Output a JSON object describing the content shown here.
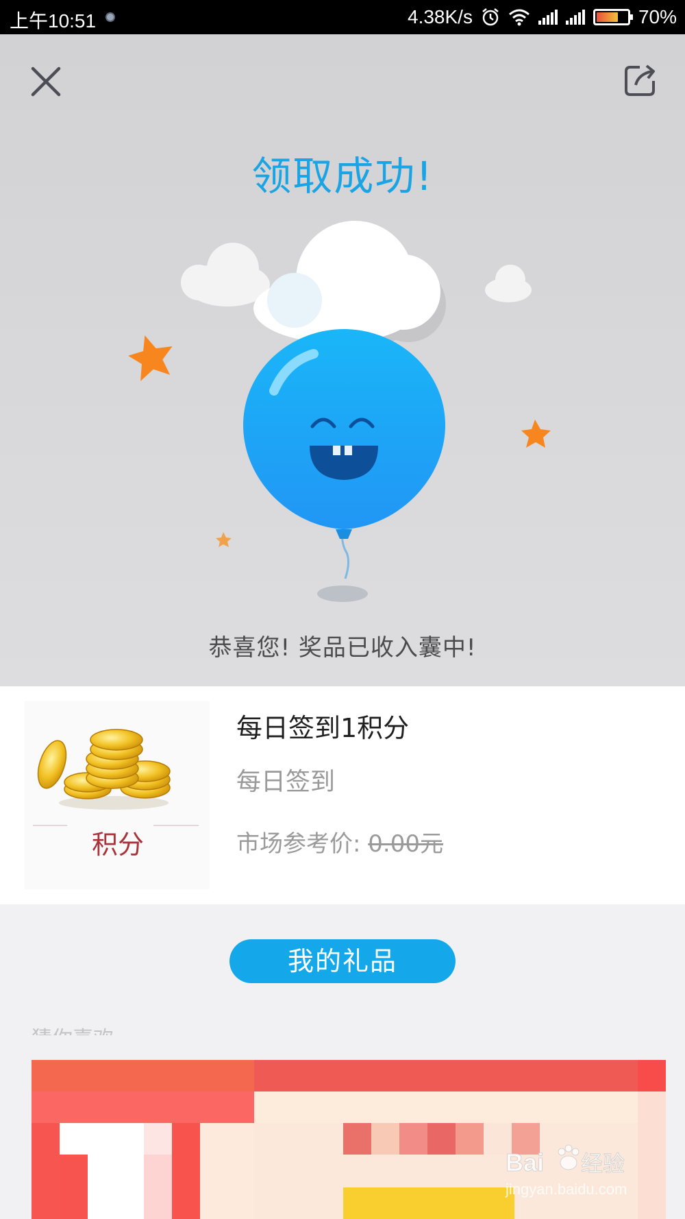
{
  "status_bar": {
    "time": "上午10:51",
    "net_speed": "4.38K/s",
    "battery": "70%",
    "battery_level": 0.7
  },
  "header": {
    "title": "领取成功!",
    "close_icon": "close-icon",
    "share_icon": "share-icon"
  },
  "illustration": {
    "description_icon": "balloon-icon"
  },
  "message": "恭喜您! 奖品已收入囊中!",
  "prize": {
    "name": "每日签到1积分",
    "subtitle": "每日签到",
    "price_label": "市场参考价: ",
    "price_value": "0.00元",
    "image_caption": "积分"
  },
  "actions": {
    "my_gifts": "我的礼品"
  },
  "recommend_label": "猜你喜欢",
  "watermark": {
    "brand": "Bai",
    "brand_suffix": "经验",
    "url": "jingyan.baidu.com"
  },
  "colors": {
    "accent": "#1ba4e4",
    "button": "#14a8ea",
    "star": "#f7861f",
    "balloon": "#1fa5f4"
  }
}
